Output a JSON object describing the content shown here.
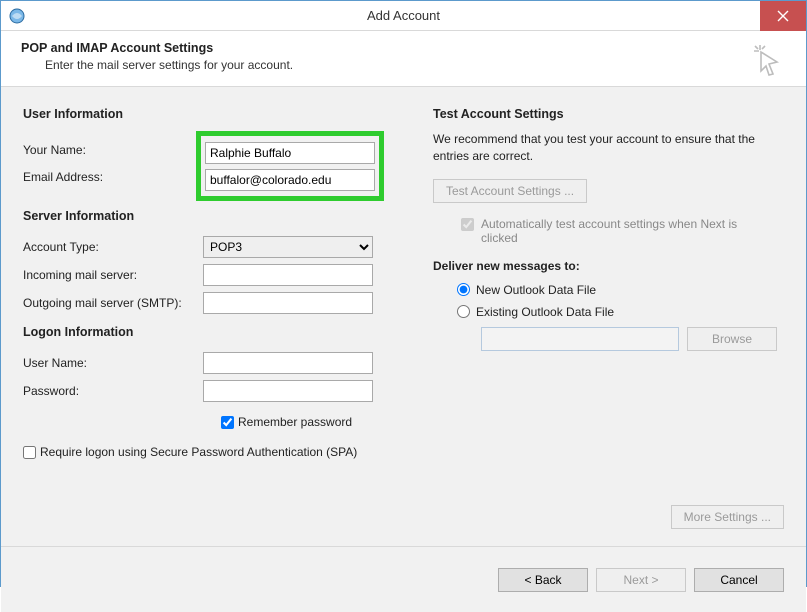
{
  "window": {
    "title": "Add Account",
    "close": "✕"
  },
  "header": {
    "title": "POP and IMAP Account Settings",
    "subtitle": "Enter the mail server settings for your account."
  },
  "left": {
    "user_info_title": "User Information",
    "your_name_label": "Your Name:",
    "your_name_value": "Ralphie Buffalo",
    "email_label": "Email Address:",
    "email_value": "buffalor@colorado.edu",
    "server_info_title": "Server Information",
    "account_type_label": "Account Type:",
    "account_type_value": "POP3",
    "incoming_label": "Incoming mail server:",
    "incoming_value": "",
    "outgoing_label": "Outgoing mail server (SMTP):",
    "outgoing_value": "",
    "logon_title": "Logon Information",
    "username_label": "User Name:",
    "username_value": "",
    "password_label": "Password:",
    "password_value": "",
    "remember_label": "Remember password",
    "spa_label": "Require logon using Secure Password Authentication (SPA)"
  },
  "right": {
    "test_title": "Test Account Settings",
    "test_text": "We recommend that you test your account to ensure that the entries are correct.",
    "test_button": "Test Account Settings ...",
    "auto_test_label": "Automatically test account settings when Next is clicked",
    "deliver_title": "Deliver new messages to:",
    "radio_new": "New Outlook Data File",
    "radio_existing": "Existing Outlook Data File",
    "browse": "Browse",
    "more_settings": "More Settings ..."
  },
  "footer": {
    "back": "< Back",
    "next": "Next >",
    "cancel": "Cancel"
  }
}
